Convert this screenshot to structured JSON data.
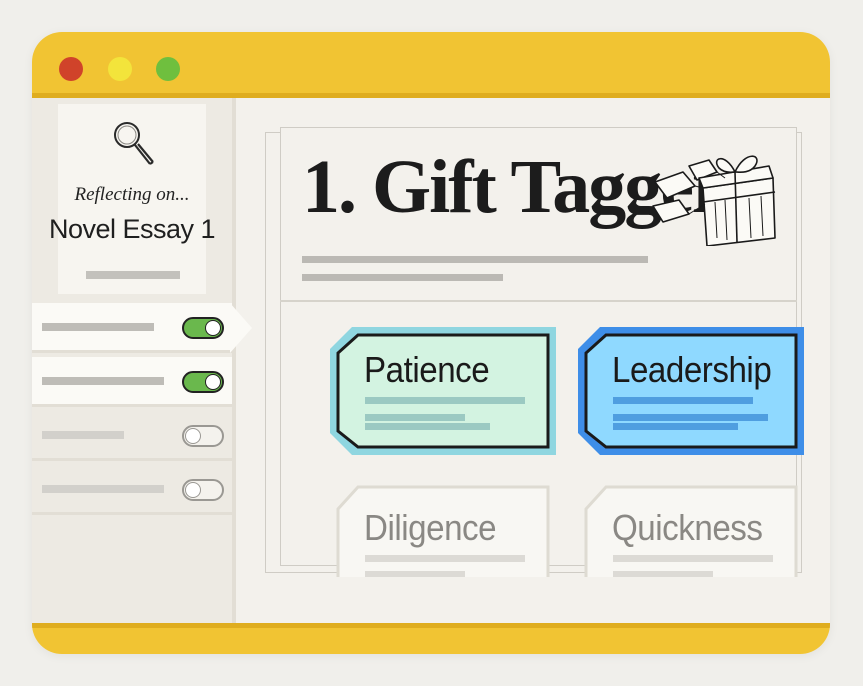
{
  "window": {
    "controls": [
      "close",
      "minimize",
      "maximize"
    ],
    "accent_color": "#f1c433"
  },
  "sidebar": {
    "document": {
      "reflecting_label": "Reflecting on...",
      "title": "Novel Essay 1",
      "icon": "magnifying-glass-icon"
    },
    "toggles": [
      {
        "on": true,
        "selected": true
      },
      {
        "on": true,
        "selected": false
      },
      {
        "on": false,
        "selected": false
      },
      {
        "on": false,
        "selected": false
      }
    ]
  },
  "main": {
    "title": "1. Gift Tagger",
    "illustration": "gift-box-icon",
    "tags": [
      {
        "label": "Patience",
        "color": "#d3f3e1",
        "border": "#1a1a1a",
        "outline": "#8fd6e0"
      },
      {
        "label": "Leadership",
        "color": "#8fd9ff",
        "border": "#1a1a1a",
        "outline": "#3e8ee8"
      },
      {
        "label": "Diligence",
        "color": "#f8f7f3",
        "border": "#dedbd2"
      },
      {
        "label": "Quickness",
        "color": "#f8f7f3",
        "border": "#dedbd2"
      }
    ]
  }
}
